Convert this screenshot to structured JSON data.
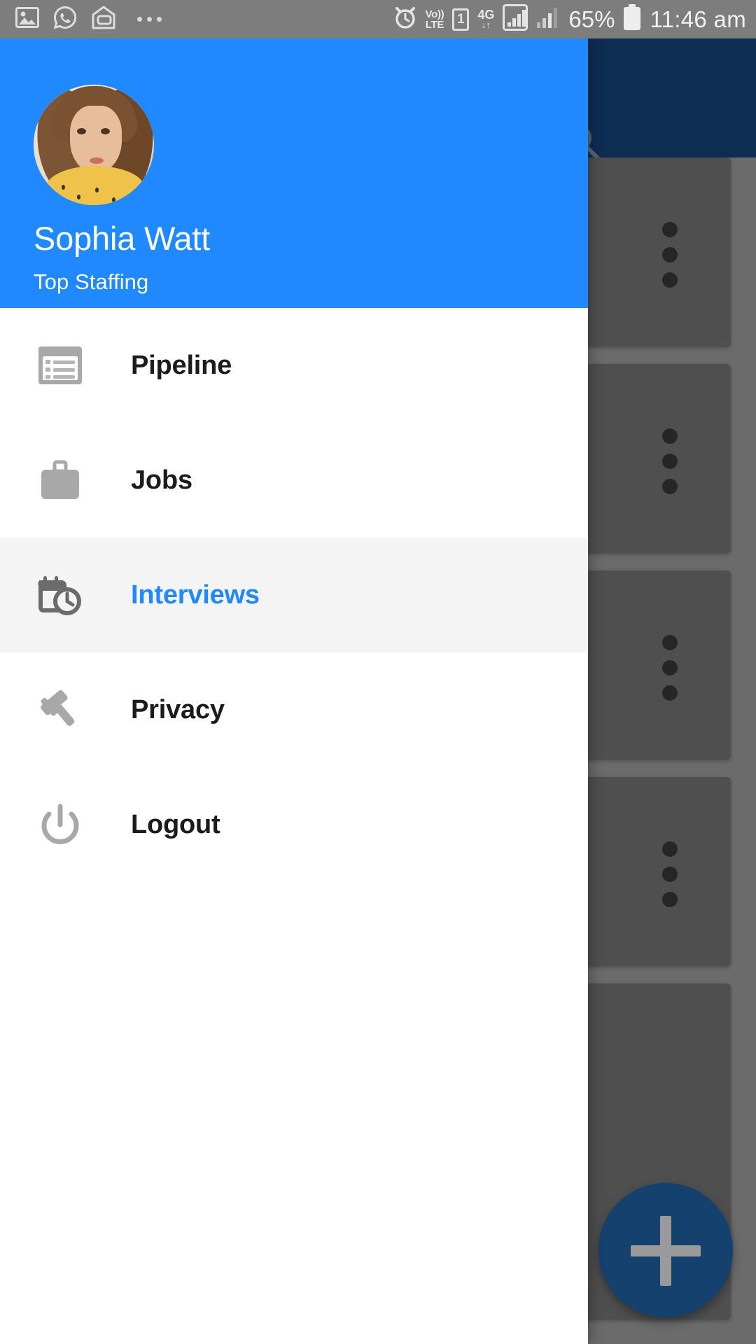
{
  "status_bar": {
    "left_icons": [
      "image-icon",
      "whatsapp-icon",
      "mail-icon",
      "overflow-dots-icon"
    ],
    "alarm_icon": "alarm-icon",
    "volte_line1": "Vo))",
    "volte_line2": "LTE",
    "sim_label": "1",
    "network_type": "4G",
    "network_arrows": "↓↑",
    "signal_icon_1": "signal-bars-boxed-icon",
    "signal_icon_2": "signal-bars-icon",
    "battery_percent": "65%",
    "battery_icon": "battery-icon",
    "time": "11:46 am"
  },
  "drawer": {
    "header": {
      "avatar": "user-avatar-photo",
      "name": "Sophia Watt",
      "organization": "Top Staffing",
      "background_color": "#2089ff"
    },
    "items": [
      {
        "id": "pipeline",
        "label": "Pipeline",
        "icon": "list-document-icon",
        "selected": false
      },
      {
        "id": "jobs",
        "label": "Jobs",
        "icon": "briefcase-icon",
        "selected": false
      },
      {
        "id": "interviews",
        "label": "Interviews",
        "icon": "calendar-clock-icon",
        "selected": true
      },
      {
        "id": "privacy",
        "label": "Privacy",
        "icon": "gavel-icon",
        "selected": false
      },
      {
        "id": "logout",
        "label": "Logout",
        "icon": "power-icon",
        "selected": false
      }
    ],
    "selected_color": "#2089ff",
    "selected_row_background": "#f4f4f4",
    "icon_color": "#a8a8a8"
  },
  "background_app": {
    "app_bar_color": "#0d2d52",
    "search_icon": "search-icon",
    "scrim_color": "#6b6b6b",
    "cards": [
      {
        "id": "card-1",
        "menu_icon": "kebab-menu-icon"
      },
      {
        "id": "card-2",
        "menu_icon": "kebab-menu-icon"
      },
      {
        "id": "card-3",
        "menu_icon": "kebab-menu-icon"
      },
      {
        "id": "card-4",
        "menu_icon": "kebab-menu-icon"
      },
      {
        "id": "card-5",
        "menu_icon": "kebab-menu-icon"
      }
    ],
    "fab": {
      "icon": "plus-icon",
      "color": "#14416e"
    }
  }
}
